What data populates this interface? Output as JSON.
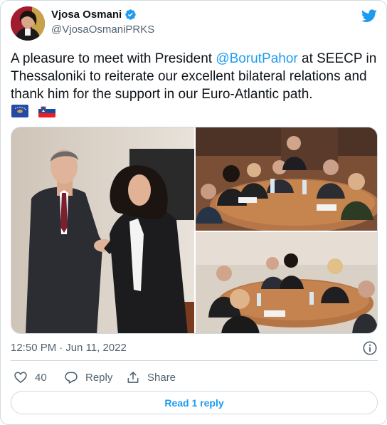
{
  "author": {
    "display_name": "Vjosa Osmani",
    "handle": "@VjosaOsmaniPRKS",
    "verified": true,
    "avatar_icon": "profile-avatar"
  },
  "logo_icon": "twitter-bird-icon",
  "tweet": {
    "text_before": "A pleasure to meet with President ",
    "mention": "@BorutPahor",
    "text_after": " at SEECP in Thessaloniki to reiterate our excellent bilateral relations and thank him for the support in our Euro-Atlantic path.",
    "flags": [
      "flag-kosovo",
      "flag-slovenia"
    ]
  },
  "media": {
    "photos": [
      "handshake-photo",
      "meeting-table-photo-1",
      "meeting-table-photo-2"
    ]
  },
  "meta": {
    "time": "12:50 PM",
    "separator": "·",
    "date": "Jun 11, 2022"
  },
  "actions": {
    "like_count": "40",
    "reply_label": "Reply",
    "share_label": "Share"
  },
  "read_reply_label": "Read 1 reply",
  "colors": {
    "accent": "#1d9bf0",
    "text": "#0f1419",
    "secondary": "#536471",
    "border": "#cfd9de"
  }
}
